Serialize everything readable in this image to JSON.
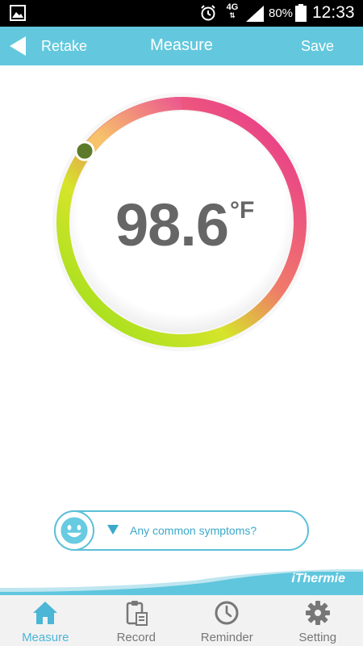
{
  "status_bar": {
    "network": "4G",
    "battery_percent": "80%",
    "time": "12:33"
  },
  "header": {
    "back_label": "Retake",
    "title": "Measure",
    "save_label": "Save"
  },
  "reading": {
    "value": "98.6",
    "unit": "°F",
    "indicator_color": "#5c7a2a"
  },
  "symptoms": {
    "prompt": "Any common symptoms?",
    "icon": "smiley-face-icon"
  },
  "brand": "iThermie",
  "nav": {
    "tabs": [
      {
        "label": "Measure",
        "icon": "home-icon",
        "active": true
      },
      {
        "label": "Record",
        "icon": "clipboard-icon",
        "active": false
      },
      {
        "label": "Reminder",
        "icon": "clock-icon",
        "active": false
      },
      {
        "label": "Setting",
        "icon": "gear-icon",
        "active": false
      }
    ]
  },
  "colors": {
    "header": "#63c8dd",
    "accent": "#4cb6d6",
    "ring_hot": "#e93b8c",
    "ring_cool": "#a6e01e"
  }
}
